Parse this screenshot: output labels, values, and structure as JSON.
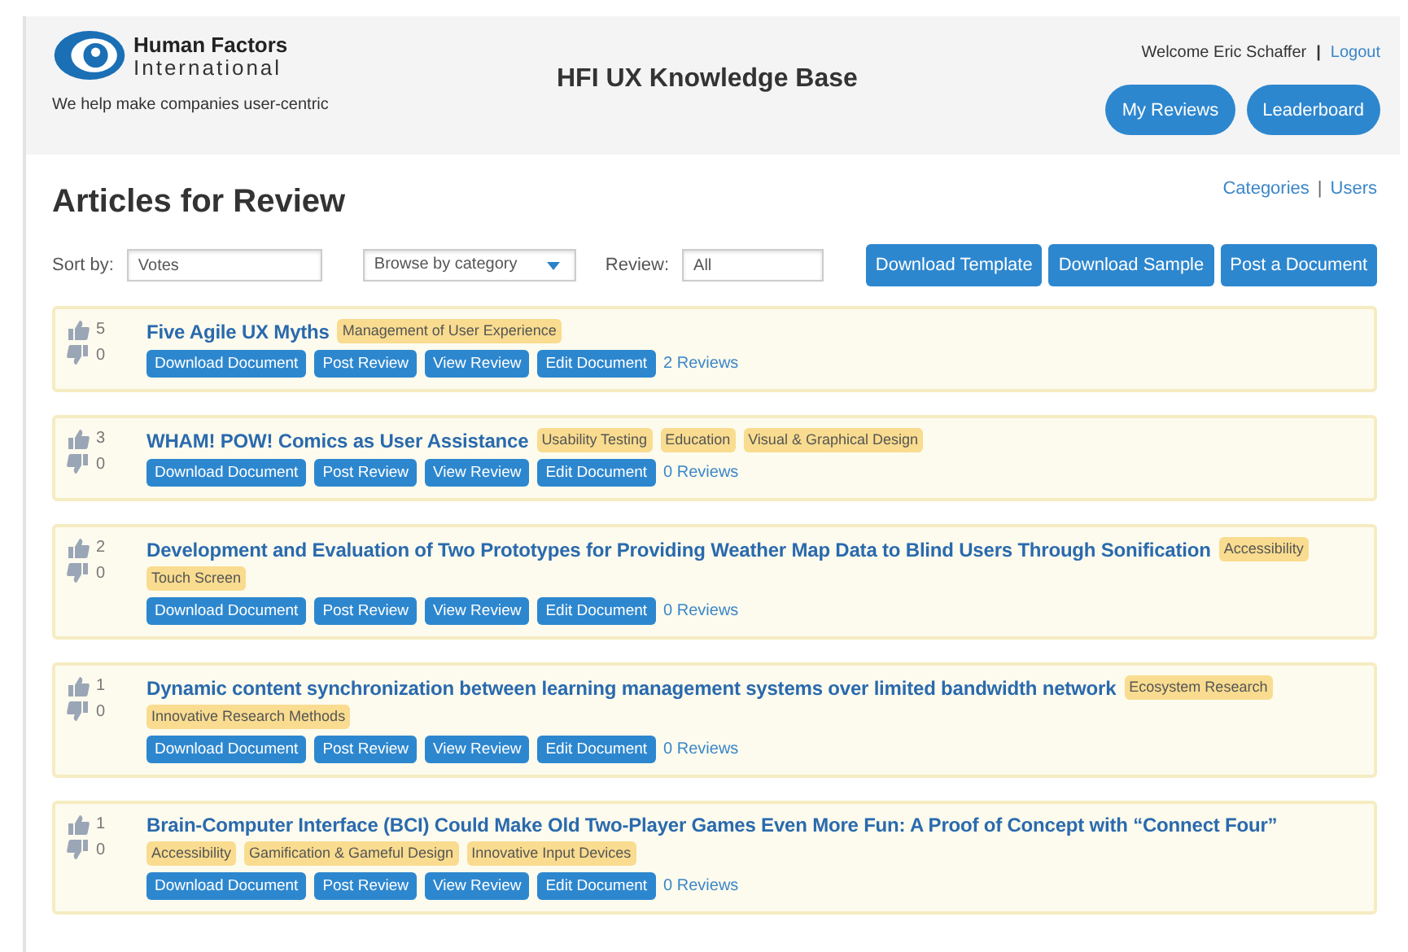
{
  "header": {
    "brand_line1": "Human Factors",
    "brand_line2": "International",
    "tagline": "We help make companies user-centric",
    "site_title": "HFI UX Knowledge Base",
    "welcome": "Welcome Eric Schaffer",
    "separator": "|",
    "logout": "Logout",
    "buttons": [
      "My Reviews",
      "Leaderboard"
    ]
  },
  "page": {
    "heading": "Articles for Review",
    "links": [
      "Categories",
      "Users"
    ],
    "link_separator": "|"
  },
  "filters": {
    "sort_label": "Sort by:",
    "sort_value": "Votes",
    "category_value": "Browse by category",
    "review_label": "Review:",
    "review_value": "All",
    "buttons": [
      "Download Template",
      "Download Sample",
      "Post a Document"
    ]
  },
  "articles": [
    {
      "up": "5",
      "down": "0",
      "title": "Five Agile UX Myths",
      "tags": [
        "Management of User Experience"
      ],
      "actions": [
        "Download Document",
        "Post Review",
        "View Review",
        "Edit Document"
      ],
      "reviews": "2 Reviews"
    },
    {
      "up": "3",
      "down": "0",
      "title": "WHAM! POW! Comics as User Assistance",
      "tags": [
        "Usability Testing",
        "Education",
        "Visual & Graphical Design"
      ],
      "actions": [
        "Download Document",
        "Post Review",
        "View Review",
        "Edit Document"
      ],
      "reviews": "0 Reviews"
    },
    {
      "up": "2",
      "down": "0",
      "title": "Development and Evaluation of Two Prototypes for Providing Weather Map Data to Blind Users Through Sonification",
      "tags": [
        "Accessibility",
        "Touch Screen"
      ],
      "actions": [
        "Download Document",
        "Post Review",
        "View Review",
        "Edit Document"
      ],
      "reviews": "0 Reviews"
    },
    {
      "up": "1",
      "down": "0",
      "title": "Dynamic content synchronization between learning management systems over limited bandwidth network",
      "tags": [
        "Ecosystem Research",
        "Innovative Research Methods"
      ],
      "actions": [
        "Download Document",
        "Post Review",
        "View Review",
        "Edit Document"
      ],
      "reviews": "0 Reviews"
    },
    {
      "up": "1",
      "down": "0",
      "title": "Brain-Computer Interface (BCI) Could Make Old Two-Player Games Even More Fun: A Proof of Concept with “Connect Four”",
      "tags": [
        "Accessibility",
        "Gamification & Gameful Design",
        "Innovative Input Devices"
      ],
      "actions": [
        "Download Document",
        "Post Review",
        "View Review",
        "Edit Document"
      ],
      "reviews": "0 Reviews"
    }
  ]
}
